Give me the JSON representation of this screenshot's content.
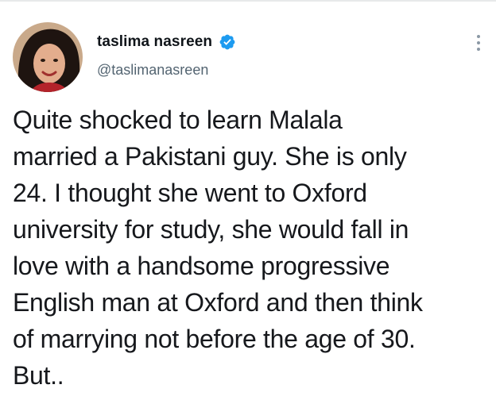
{
  "tweet": {
    "author": {
      "display_name": "taslima nasreen",
      "handle": "@taslimanasreen",
      "verified": true,
      "avatar_icon": "profile-photo"
    },
    "more_icon": "more-options-icon",
    "text_lines": [
      "Quite shocked to learn Malala",
      "married a Pakistani guy. She is only",
      "24. I thought she went to Oxford",
      "university for study, she would fall in",
      "love with a handsome progressive",
      "English man at Oxford and then think",
      "of marrying not before the age of 30.",
      "But.."
    ]
  },
  "colors": {
    "verified_blue": "#1d9bf0",
    "text_primary": "#0f1419",
    "text_secondary": "#536471",
    "divider": "#e7e9ea"
  }
}
